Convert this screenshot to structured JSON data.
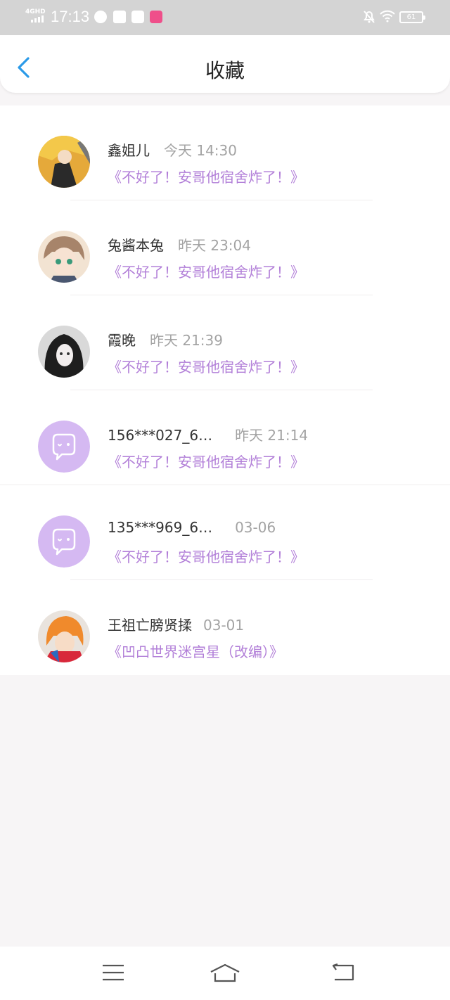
{
  "status_bar": {
    "network": "4GHD",
    "time": "17:13",
    "battery": "61"
  },
  "header": {
    "back_icon": "chevron-left-icon",
    "title": "收藏"
  },
  "colors": {
    "accent_blue": "#2b9ae8",
    "work_title_purple": "#b27fd8",
    "default_avatar_purple": "#d5b9f2"
  },
  "favorites": [
    {
      "name": "鑫姐儿",
      "time": "今天 14:30",
      "work": "《不好了！安哥他宿舍炸了！》",
      "avatar": "photo-avatar-1"
    },
    {
      "name": "兔酱本兔",
      "time": "昨天 23:04",
      "work": "《不好了！安哥他宿舍炸了！》",
      "avatar": "photo-avatar-2"
    },
    {
      "name": "霞晚",
      "time": "昨天 21:39",
      "work": "《不好了！安哥他宿舍炸了！》",
      "avatar": "photo-avatar-3"
    },
    {
      "name": "156***027_6…",
      "time": "昨天 21:14",
      "work": "《不好了！安哥他宿舍炸了！》",
      "avatar": "default-avatar-icon"
    },
    {
      "name": "135***969_6…",
      "time": "03-06",
      "work": "《不好了！安哥他宿舍炸了！》",
      "avatar": "default-avatar-icon"
    },
    {
      "name": "王祖亡膀贤揉",
      "time": "03-01",
      "work": "《凹凸世界迷宫星（改编）》",
      "avatar": "photo-avatar-6"
    }
  ],
  "nav_bar": {
    "menu_icon": "menu-icon",
    "home_icon": "home-icon",
    "back_icon": "back-icon"
  }
}
